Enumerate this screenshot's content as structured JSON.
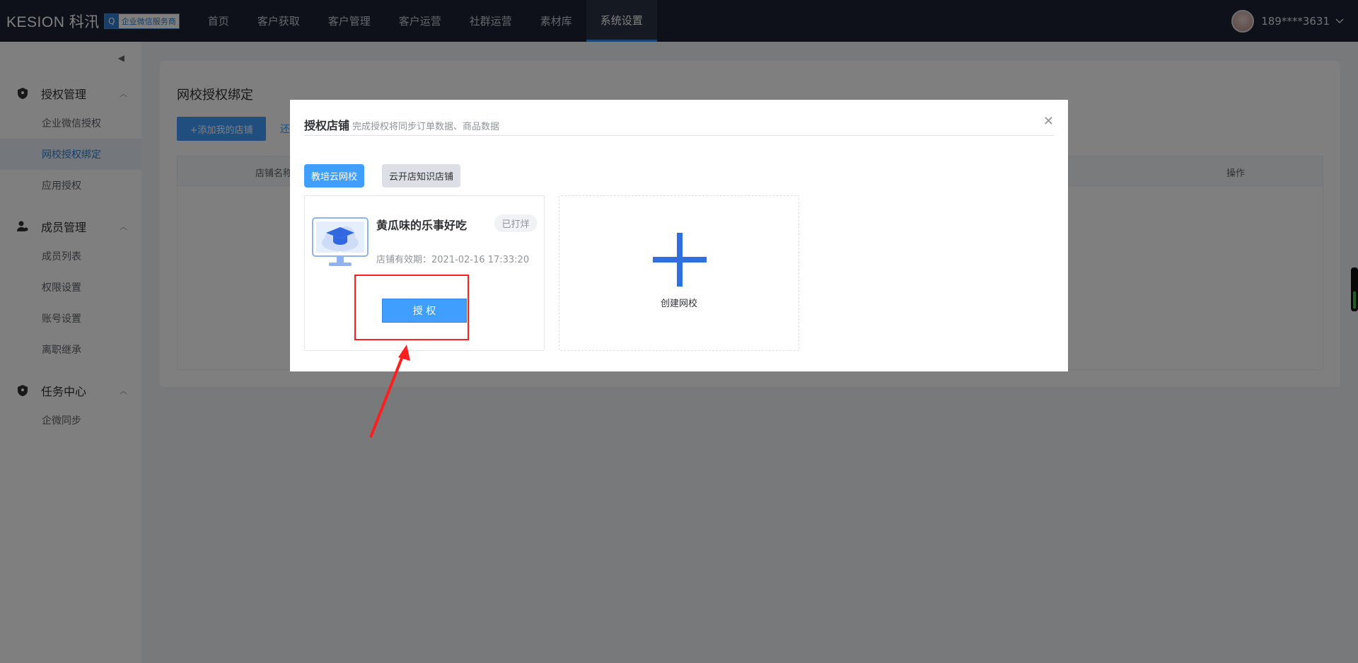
{
  "brand": {
    "name": "KESION 科汛",
    "badge_icon": "Q",
    "badge_text": "企业微信服务商"
  },
  "nav": [
    {
      "label": "首页"
    },
    {
      "label": "客户获取"
    },
    {
      "label": "客户管理"
    },
    {
      "label": "客户运营"
    },
    {
      "label": "社群运营"
    },
    {
      "label": "素材库"
    },
    {
      "label": "系统设置",
      "active": true
    }
  ],
  "user": {
    "phone": "189****3631"
  },
  "sidebar": {
    "groups": [
      {
        "title": "授权管理",
        "icon": "shield-icon",
        "items": [
          "企业微信授权",
          "网校授权绑定",
          "应用授权"
        ]
      },
      {
        "title": "成员管理",
        "icon": "user-gear-icon",
        "items": [
          "成员列表",
          "权限设置",
          "账号设置",
          "离职继承"
        ]
      },
      {
        "title": "任务中心",
        "icon": "shield-icon",
        "items": [
          "企微同步"
        ]
      }
    ],
    "active_item": "网校授权绑定"
  },
  "page": {
    "title": "网校授权绑定",
    "add_button": "+添加我的店铺",
    "link_fragment": "还",
    "table": {
      "col_store": "店铺名称",
      "col_action": "操作"
    }
  },
  "dialog": {
    "title": "授权店铺",
    "subtitle": "完成授权将同步订单数据、商品数据",
    "tabs": [
      "教培云网校",
      "云开店知识店铺"
    ],
    "store": {
      "name": "黄瓜味的乐事好吃",
      "status": "已打烊",
      "valid_label": "店铺有效期：",
      "valid_value": "2021-02-16 17:33:20",
      "auth_button": "授 权"
    },
    "create_label": "创建网校"
  },
  "colors": {
    "primary": "#409eff",
    "topbar": "#1d2333",
    "highlight": "#ff1f1f"
  }
}
